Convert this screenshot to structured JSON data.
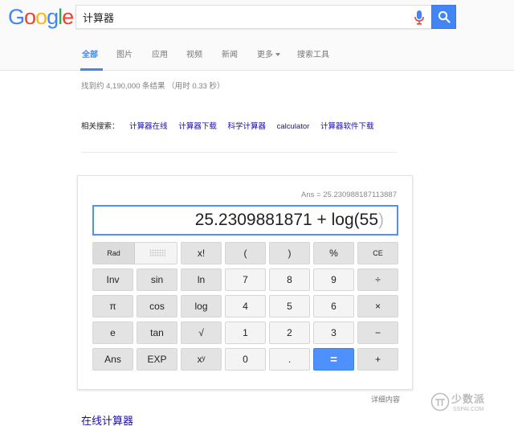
{
  "header": {
    "logo_letters": [
      {
        "ch": "G",
        "color": "#4285f4"
      },
      {
        "ch": "o",
        "color": "#ea4335"
      },
      {
        "ch": "o",
        "color": "#fbbc05"
      },
      {
        "ch": "g",
        "color": "#4285f4"
      },
      {
        "ch": "l",
        "color": "#34a853"
      },
      {
        "ch": "e",
        "color": "#ea4335"
      }
    ],
    "search_query": "计算器",
    "search_button_icon": "magnifier-icon",
    "mic_icon": "microphone-icon"
  },
  "tabs": [
    {
      "label": "全部",
      "active": true
    },
    {
      "label": "图片",
      "active": false
    },
    {
      "label": "应用",
      "active": false
    },
    {
      "label": "视频",
      "active": false
    },
    {
      "label": "新闻",
      "active": false
    },
    {
      "label": "更多",
      "active": false,
      "has_caret": true
    },
    {
      "label": "搜索工具",
      "active": false
    }
  ],
  "result_stats": "找到约 4,190,000 条结果 （用时 0.33 秒）",
  "related": {
    "label": "相关搜索：",
    "links": [
      "计算器在线",
      "计算器下载",
      "科学计算器",
      "calculator",
      "计算器软件下载"
    ]
  },
  "calculator": {
    "ans_line": "Ans = 25.230988187113887",
    "expression": "25.2309881871 + log(55",
    "ghost_paren": ")",
    "rad_label": "Rad",
    "rows": [
      [
        {
          "label": "x!",
          "style": "fn"
        },
        {
          "label": "(",
          "style": "fn"
        },
        {
          "label": ")",
          "style": "fn"
        },
        {
          "label": "%",
          "style": "fn"
        },
        {
          "label": "CE",
          "style": "fn"
        }
      ],
      [
        {
          "label": "Inv",
          "style": "fn"
        },
        {
          "label": "sin",
          "style": "fn"
        },
        {
          "label": "ln",
          "style": "fn"
        },
        {
          "label": "7",
          "style": "num"
        },
        {
          "label": "8",
          "style": "num"
        },
        {
          "label": "9",
          "style": "num"
        },
        {
          "label": "÷",
          "style": "fn"
        }
      ],
      [
        {
          "label": "π",
          "style": "fn"
        },
        {
          "label": "cos",
          "style": "fn"
        },
        {
          "label": "log",
          "style": "fn"
        },
        {
          "label": "4",
          "style": "num"
        },
        {
          "label": "5",
          "style": "num"
        },
        {
          "label": "6",
          "style": "num"
        },
        {
          "label": "×",
          "style": "fn"
        }
      ],
      [
        {
          "label": "e",
          "style": "fn"
        },
        {
          "label": "tan",
          "style": "fn"
        },
        {
          "label": "√",
          "style": "fn"
        },
        {
          "label": "1",
          "style": "num"
        },
        {
          "label": "2",
          "style": "num"
        },
        {
          "label": "3",
          "style": "num"
        },
        {
          "label": "−",
          "style": "fn"
        }
      ],
      [
        {
          "label": "Ans",
          "style": "fn"
        },
        {
          "label": "EXP",
          "style": "fn"
        },
        {
          "label": "xʸ",
          "style": "fn"
        },
        {
          "label": "0",
          "style": "num"
        },
        {
          "label": ".",
          "style": "num"
        },
        {
          "label": "=",
          "style": "eq"
        },
        {
          "label": "+",
          "style": "fn"
        }
      ]
    ]
  },
  "more_info": "详细内容",
  "next_result_title": "在线计算器",
  "watermark": {
    "text": "少数派",
    "sub": "SSPAI.COM"
  }
}
